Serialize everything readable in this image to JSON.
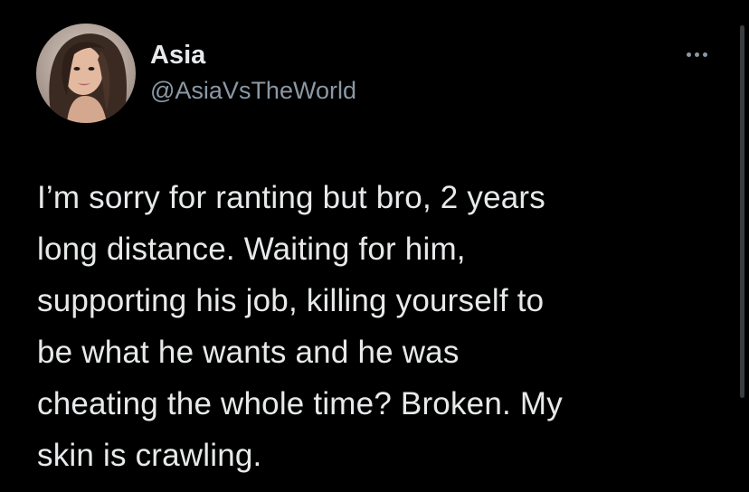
{
  "user": {
    "display_name": "Asia",
    "handle": "@AsiaVsTheWorld",
    "avatar_icon": "profile-photo-avatar"
  },
  "menu": {
    "more_icon": "more-options-icon"
  },
  "tweet": {
    "text": "I’m sorry for ranting but bro, 2 years\nlong distance. Waiting for him,\nsupporting his job, killing yourself to\nbe what he wants and he was\ncheating the whole time? Broken. My\nskin is crawling."
  },
  "colors": {
    "background": "#000000",
    "text_primary": "#e7e9ea",
    "text_secondary": "#8b98a5"
  }
}
